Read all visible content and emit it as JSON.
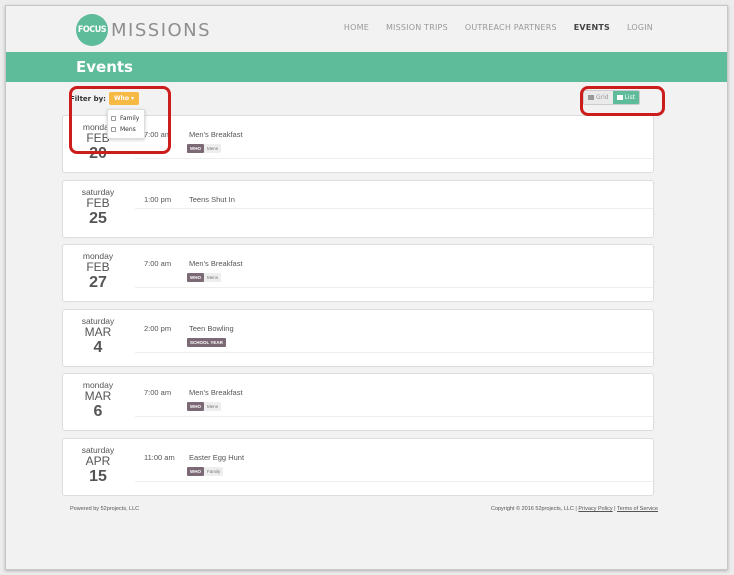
{
  "brand": {
    "logo_mark": "FOCUS",
    "logo_text": "MISSIONS"
  },
  "nav": [
    {
      "label": "HOME",
      "active": false
    },
    {
      "label": "MISSION TRIPS",
      "active": false
    },
    {
      "label": "OUTREACH PARTNERS",
      "active": false
    },
    {
      "label": "EVENTS",
      "active": true
    },
    {
      "label": "LOGIN",
      "active": false
    }
  ],
  "page_title": "Events",
  "filter": {
    "label": "Filter by:",
    "button": "Who",
    "options": [
      {
        "label": "Family",
        "checked": false
      },
      {
        "label": "Mens",
        "checked": false
      }
    ]
  },
  "view_toggle": {
    "grid": "Grid",
    "list": "List",
    "selected": "List"
  },
  "events": [
    {
      "dow": "monday",
      "month": "FEB",
      "day": "20",
      "time": "7:00 am",
      "name": "Men's Breakfast",
      "tag_key": "WHO",
      "tag_val": "Mens"
    },
    {
      "dow": "saturday",
      "month": "FEB",
      "day": "25",
      "time": "1:00 pm",
      "name": "Teens Shut In",
      "tag_key": "",
      "tag_val": ""
    },
    {
      "dow": "monday",
      "month": "FEB",
      "day": "27",
      "time": "7:00 am",
      "name": "Men's Breakfast",
      "tag_key": "WHO",
      "tag_val": "Mens"
    },
    {
      "dow": "saturday",
      "month": "MAR",
      "day": "4",
      "time": "2:00 pm",
      "name": "Teen Bowling",
      "tag_key": "SCHOOL YEAR",
      "tag_val": ""
    },
    {
      "dow": "monday",
      "month": "MAR",
      "day": "6",
      "time": "7:00 am",
      "name": "Men's Breakfast",
      "tag_key": "WHO",
      "tag_val": "Mens"
    },
    {
      "dow": "saturday",
      "month": "APR",
      "day": "15",
      "time": "11:00 am",
      "name": "Easter Egg Hunt",
      "tag_key": "WHO",
      "tag_val": "Family"
    }
  ],
  "footer": {
    "left": "Powered by 52projects, LLC",
    "copyright": "Copyright © 2016 52projects, LLC |",
    "privacy": "Privacy Policy",
    "divider": "|",
    "terms": "Terms of Service"
  },
  "colors": {
    "accent": "#5fbc9a",
    "filter_button": "#f5b944",
    "tag": "#7b6a75",
    "highlight": "#cc1d1d"
  }
}
